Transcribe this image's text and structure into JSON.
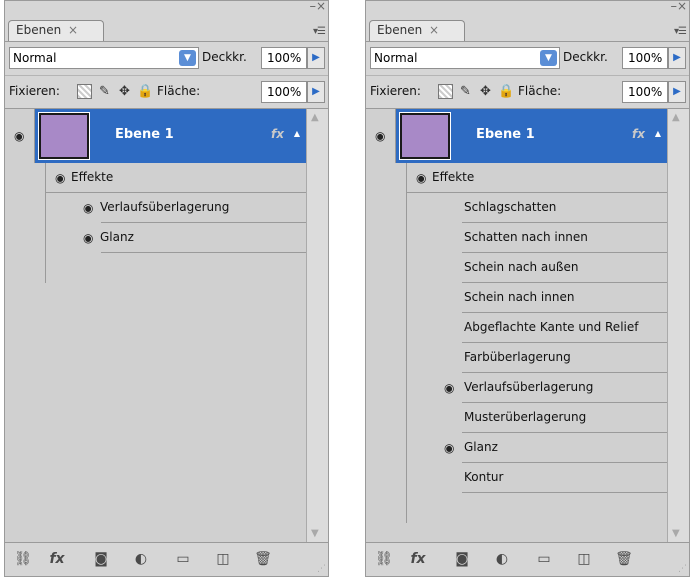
{
  "panels": [
    {
      "tab_label": "Ebenen",
      "tab_close": "×",
      "blend_mode": "Normal",
      "opacity_label": "Deckkr.",
      "opacity_value": "100%",
      "lock_label": "Fixieren:",
      "fill_label": "Fläche:",
      "fill_value": "100%",
      "layer_name": "Ebene 1",
      "fx_badge": "fx",
      "effects_label": "Effekte",
      "effects": [
        {
          "label": "Verlaufsüberlagerung",
          "visible": true
        },
        {
          "label": "Glanz",
          "visible": true
        }
      ]
    },
    {
      "tab_label": "Ebenen",
      "tab_close": "×",
      "blend_mode": "Normal",
      "opacity_label": "Deckkr.",
      "opacity_value": "100%",
      "lock_label": "Fixieren:",
      "fill_label": "Fläche:",
      "fill_value": "100%",
      "layer_name": "Ebene 1",
      "fx_badge": "fx",
      "effects_label": "Effekte",
      "effects": [
        {
          "label": "Schlagschatten",
          "visible": false
        },
        {
          "label": "Schatten nach innen",
          "visible": false
        },
        {
          "label": "Schein nach außen",
          "visible": false
        },
        {
          "label": "Schein nach innen",
          "visible": false
        },
        {
          "label": "Abgeflachte Kante und Relief",
          "visible": false
        },
        {
          "label": "Farbüberlagerung",
          "visible": false
        },
        {
          "label": "Verlaufsüberlagerung",
          "visible": true
        },
        {
          "label": "Musterüberlagerung",
          "visible": false
        },
        {
          "label": "Glanz",
          "visible": true
        },
        {
          "label": "Kontur",
          "visible": false
        }
      ]
    }
  ],
  "footer_icons": [
    "link-layers-icon",
    "fx-icon",
    "layer-mask-icon",
    "adjustment-layer-icon",
    "new-group-icon",
    "new-layer-icon",
    "trash-icon"
  ],
  "colors": {
    "selection": "#2e6bc2",
    "thumbnail": "#a889c7",
    "panel_bg": "#d6d6d6"
  }
}
